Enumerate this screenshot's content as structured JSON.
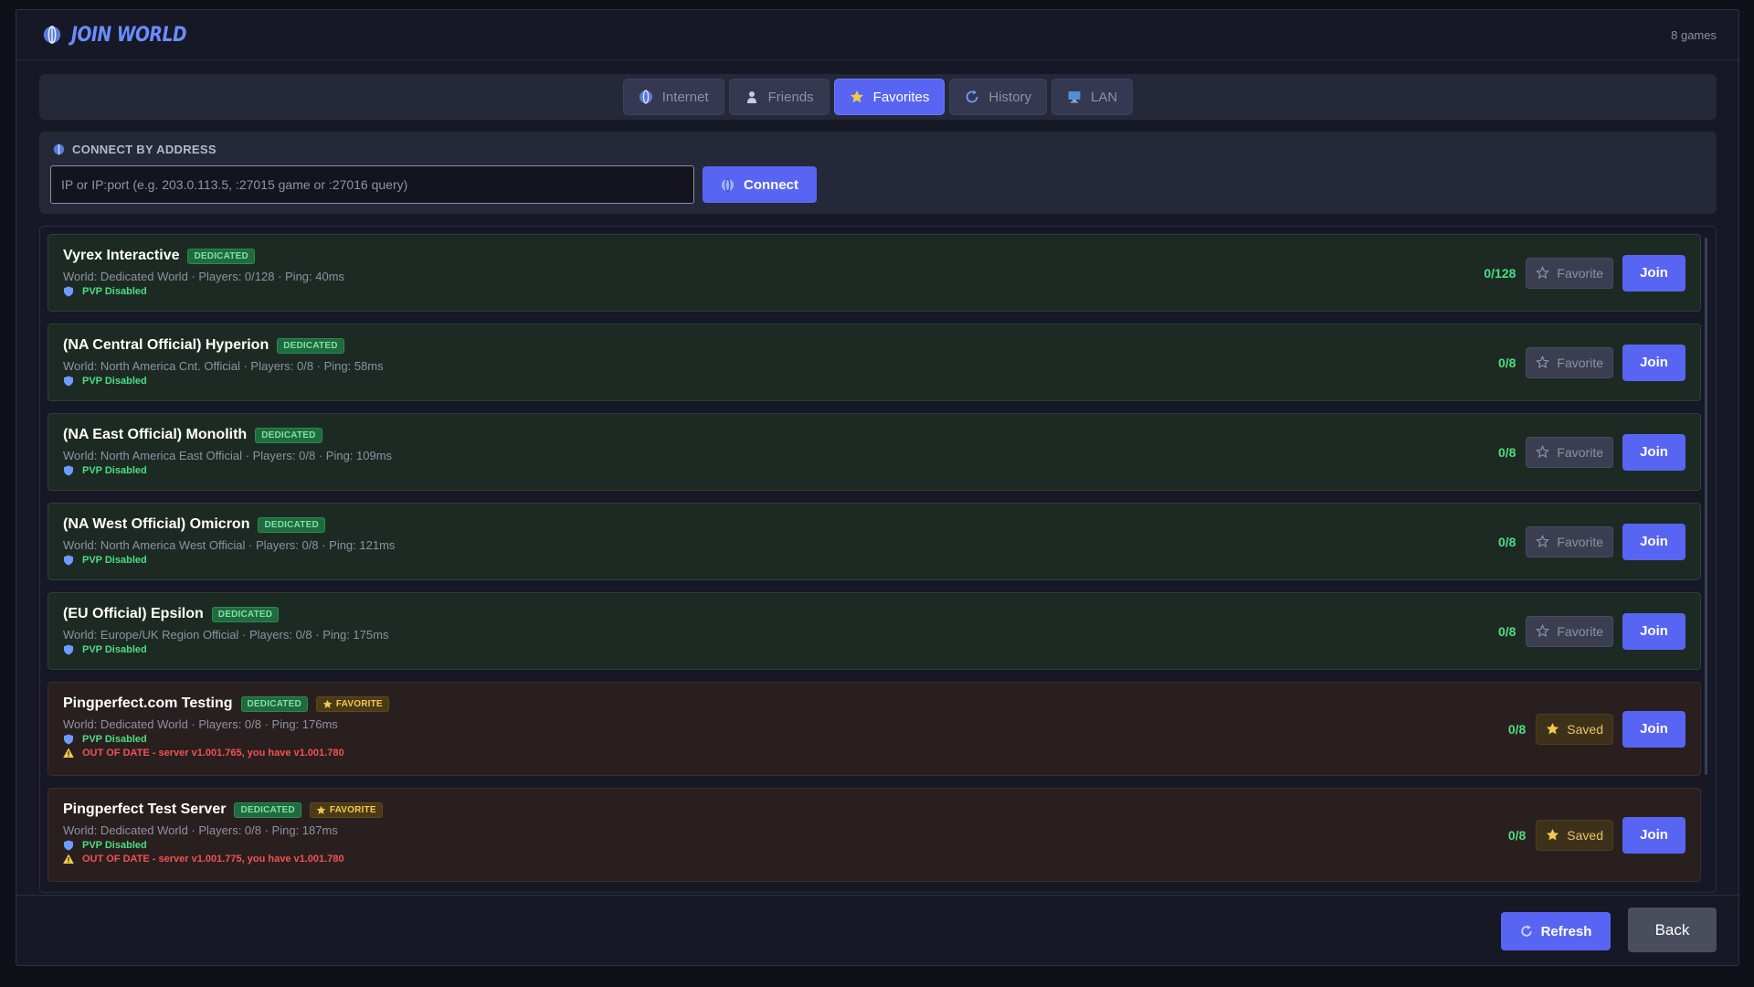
{
  "window": {
    "title": "JOIN WORLD",
    "count": "8 games"
  },
  "tabs": [
    {
      "label": "Internet",
      "icon": "globe-icon",
      "active": false
    },
    {
      "label": "Friends",
      "icon": "person-icon",
      "active": false
    },
    {
      "label": "Favorites",
      "icon": "star-icon",
      "active": true
    },
    {
      "label": "History",
      "icon": "history-icon",
      "active": false
    },
    {
      "label": "LAN",
      "icon": "monitor-icon",
      "active": false
    }
  ],
  "connect": {
    "label": "CONNECT BY ADDRESS",
    "placeholder": "IP or IP:port (e.g. 203.0.113.5, :27015 game or :27016 query)",
    "value": "",
    "button_label": "Connect"
  },
  "servers": [
    {
      "name": "Vyrex Interactive",
      "badge": "DEDICATED",
      "favorite": false,
      "meta": "World: Dedicated World · Players: 0/128 · Ping: 40ms",
      "pvp": "PVP Disabled",
      "players": "0/128",
      "action_label": "Favorite",
      "join_label": "Join"
    },
    {
      "name": "(NA Central Official) Hyperion",
      "badge": "DEDICATED",
      "favorite": false,
      "meta": "World: North America Cnt. Official · Players: 0/8 · Ping: 58ms",
      "pvp": "PVP Disabled",
      "players": "0/8",
      "action_label": "Favorite",
      "join_label": "Join"
    },
    {
      "name": "(NA East Official) Monolith",
      "badge": "DEDICATED",
      "favorite": false,
      "meta": "World: North America East Official · Players: 0/8 · Ping: 109ms",
      "pvp": "PVP Disabled",
      "players": "0/8",
      "action_label": "Favorite",
      "join_label": "Join"
    },
    {
      "name": "(NA West Official) Omicron",
      "badge": "DEDICATED",
      "favorite": false,
      "meta": "World: North America West Official · Players: 0/8 · Ping: 121ms",
      "pvp": "PVP Disabled",
      "players": "0/8",
      "action_label": "Favorite",
      "join_label": "Join"
    },
    {
      "name": "(EU Official) Epsilon",
      "badge": "DEDICATED",
      "favorite": false,
      "meta": "World: Europe/UK Region Official · Players: 0/8 · Ping: 175ms",
      "pvp": "PVP Disabled",
      "players": "0/8",
      "action_label": "Favorite",
      "join_label": "Join"
    },
    {
      "name": "Pingperfect.com Testing",
      "badge": "DEDICATED",
      "favorite": true,
      "fav_badge": "FAVORITE",
      "meta": "World: Dedicated World · Players: 0/8 · Ping: 176ms",
      "pvp": "PVP Disabled",
      "warning": "OUT OF DATE - server v1.001.765, you have v1.001.780",
      "players": "0/8",
      "action_label": "Saved",
      "join_label": "Join"
    },
    {
      "name": "Pingperfect Test Server",
      "badge": "DEDICATED",
      "favorite": true,
      "fav_badge": "FAVORITE",
      "meta": "World: Dedicated World · Players: 0/8 · Ping: 187ms",
      "pvp": "PVP Disabled",
      "warning": "OUT OF DATE - server v1.001.775, you have v1.001.780",
      "players": "0/8",
      "action_label": "Saved",
      "join_label": "Join"
    }
  ],
  "footer": {
    "refresh_label": "Refresh",
    "back_label": "Back"
  },
  "colors": {
    "accent": "#5865f2",
    "title": "#6b8cff",
    "players": "#4ade80",
    "warning": "#f05252",
    "favorite": "#f2c94c"
  }
}
